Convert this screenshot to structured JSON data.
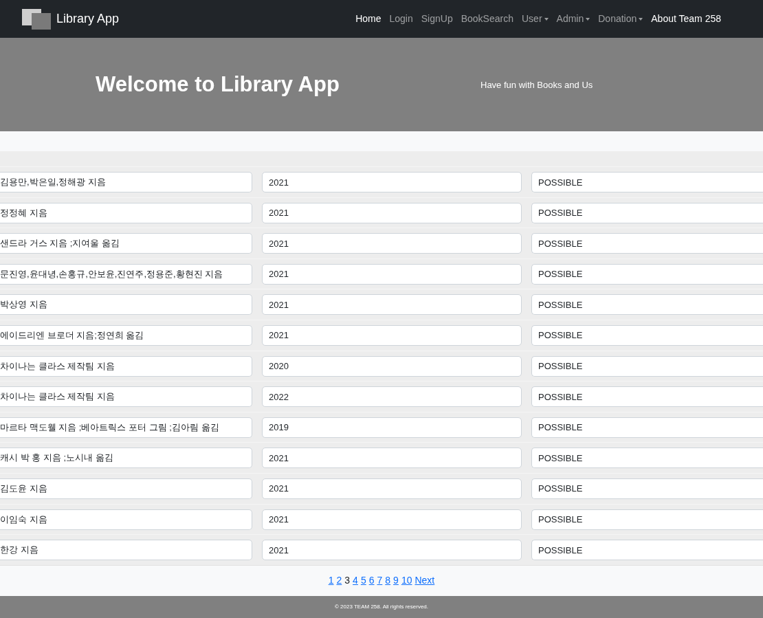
{
  "navbar": {
    "brand": "Library App",
    "items": [
      {
        "label": "Home",
        "active": true,
        "dropdown": false
      },
      {
        "label": "Login",
        "active": false,
        "dropdown": false
      },
      {
        "label": "SignUp",
        "active": false,
        "dropdown": false
      },
      {
        "label": "BookSearch",
        "active": false,
        "dropdown": false
      },
      {
        "label": "User",
        "active": false,
        "dropdown": true
      },
      {
        "label": "Admin",
        "active": false,
        "dropdown": true
      },
      {
        "label": "Donation",
        "active": false,
        "dropdown": true
      },
      {
        "label": "About Team 258",
        "active": true,
        "dropdown": false
      }
    ]
  },
  "hero": {
    "title": "Welcome to Library App",
    "subtitle": "Have fun with Books and Us"
  },
  "table": {
    "rows": [
      {
        "author": "김용만,박은일,정해광 지음",
        "year": "2021",
        "status": "POSSIBLE"
      },
      {
        "author": "정정혜 지음",
        "year": "2021",
        "status": "POSSIBLE"
      },
      {
        "author": "샌드라 거스 지음 ;지여울 옮김",
        "year": "2021",
        "status": "POSSIBLE"
      },
      {
        "author": "문진영,윤대녕,손홍규,안보윤,진연주,정용준,황현진 지음",
        "year": "2021",
        "status": "POSSIBLE"
      },
      {
        "author": "박상영 지음",
        "year": "2021",
        "status": "POSSIBLE"
      },
      {
        "author": "에이드리엔 브로더 지음;정연희 옮김",
        "year": "2021",
        "status": "POSSIBLE"
      },
      {
        "author": "차이나는 클라스 제작팀 지음",
        "year": "2020",
        "status": "POSSIBLE"
      },
      {
        "author": "차이나는 클라스 제작팀 지음",
        "year": "2022",
        "status": "POSSIBLE"
      },
      {
        "author": "마르타 맥도웰 지음 ;베아트릭스 포터 그림 ;김아림 옮김",
        "year": "2019",
        "status": "POSSIBLE"
      },
      {
        "author": "캐시 박 홍 지음 ;노시내 옮김",
        "year": "2021",
        "status": "POSSIBLE"
      },
      {
        "author": "김도윤 지음",
        "year": "2021",
        "status": "POSSIBLE"
      },
      {
        "author": "이임숙 지음",
        "year": "2021",
        "status": "POSSIBLE"
      },
      {
        "author": "한강 지음",
        "year": "2021",
        "status": "POSSIBLE"
      }
    ]
  },
  "pagination": {
    "pages": [
      {
        "label": "1",
        "selected": false
      },
      {
        "label": "2",
        "selected": false
      },
      {
        "label": "3",
        "selected": true
      },
      {
        "label": "4",
        "selected": false
      },
      {
        "label": "5",
        "selected": false
      },
      {
        "label": "6",
        "selected": false
      },
      {
        "label": "7",
        "selected": false
      },
      {
        "label": "8",
        "selected": false
      },
      {
        "label": "9",
        "selected": false
      },
      {
        "label": "10",
        "selected": false
      }
    ],
    "next": "Next"
  },
  "footer": {
    "text": "© 2023 TEAM 258. All rights reserved."
  }
}
